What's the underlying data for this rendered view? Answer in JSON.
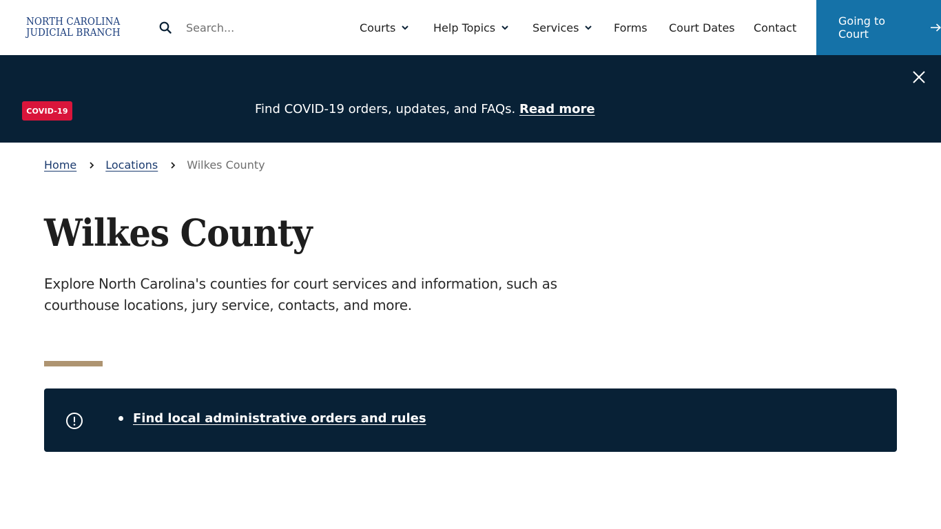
{
  "header": {
    "logo_line1": "North Carolina",
    "logo_line2": "Judicial Branch",
    "search_placeholder": "Search...",
    "search_value": "",
    "nav": [
      {
        "label": "Courts",
        "has_dropdown": true
      },
      {
        "label": "Help Topics",
        "has_dropdown": true
      },
      {
        "label": "Services",
        "has_dropdown": true
      },
      {
        "label": "Forms",
        "has_dropdown": false
      },
      {
        "label": "Court Dates",
        "has_dropdown": false
      },
      {
        "label": "Contact",
        "has_dropdown": false
      }
    ],
    "cta_label": "Going to Court",
    "cta_icon": "arrow-right-icon"
  },
  "banner": {
    "badge": "COVID-19",
    "text": "Find COVID-19 orders, updates, and FAQs.",
    "link": "Read more",
    "close_icon": "close-icon"
  },
  "breadcrumb": {
    "items": [
      {
        "label": "Home",
        "link": true
      },
      {
        "label": "Locations",
        "link": true
      },
      {
        "label": "Wilkes County",
        "link": false
      }
    ]
  },
  "page": {
    "title": "Wilkes County",
    "intro": "Explore North Carolina's counties for court services and information, such as courthouse locations, jury service, contacts, and more."
  },
  "notice": {
    "icon": "alert-circle-icon",
    "links": [
      "Find local administrative orders and rules"
    ]
  },
  "colors": {
    "brand_navy": "#082136",
    "cta_blue": "#1572a8",
    "badge_red": "#d9153b",
    "accent_tan": "#ae9471",
    "logo_blue": "#1a3d7c"
  }
}
